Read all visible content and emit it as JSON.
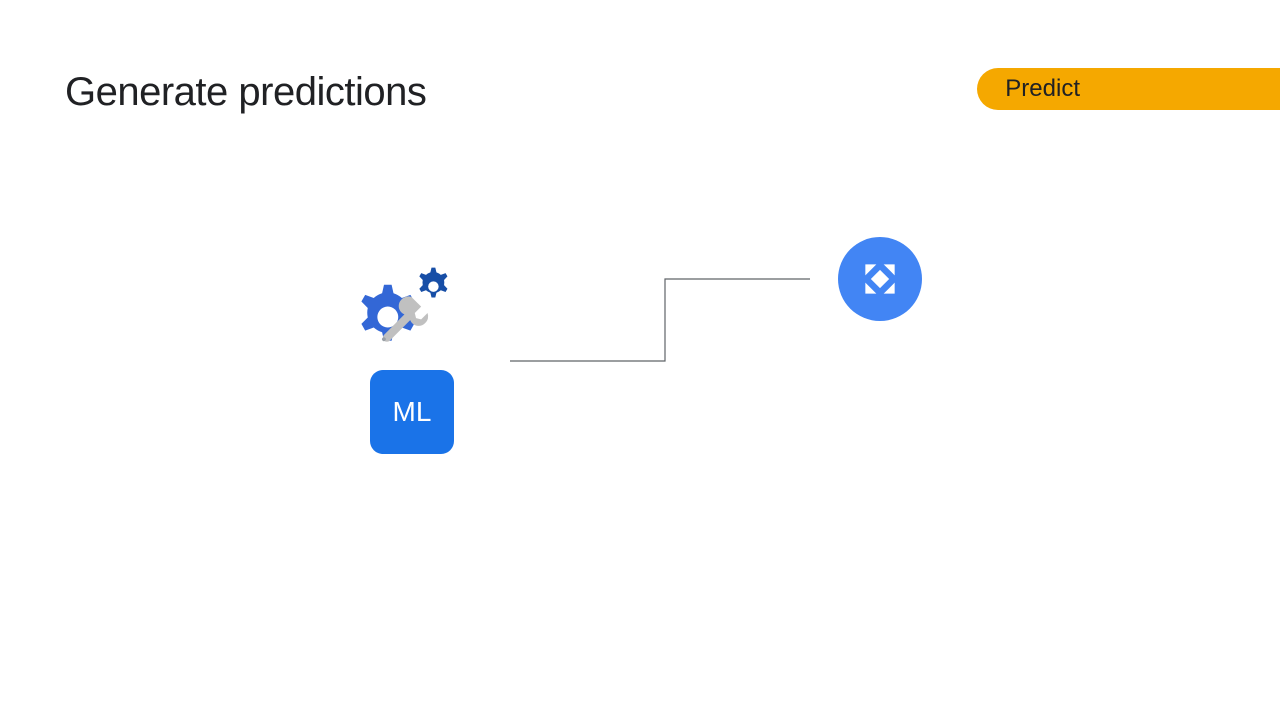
{
  "header": {
    "title": "Generate predictions",
    "badge": "Predict"
  },
  "diagram": {
    "ml_label": "ML",
    "icons": {
      "source": "gears-wrench-icon",
      "destination": "expand-arrows-icon"
    },
    "colors": {
      "ml_block": "#1a73e8",
      "badge": "#f5a800",
      "dest_circle": "#4285f4",
      "gear_primary": "#3367d6",
      "gear_secondary": "#174ea6"
    }
  }
}
